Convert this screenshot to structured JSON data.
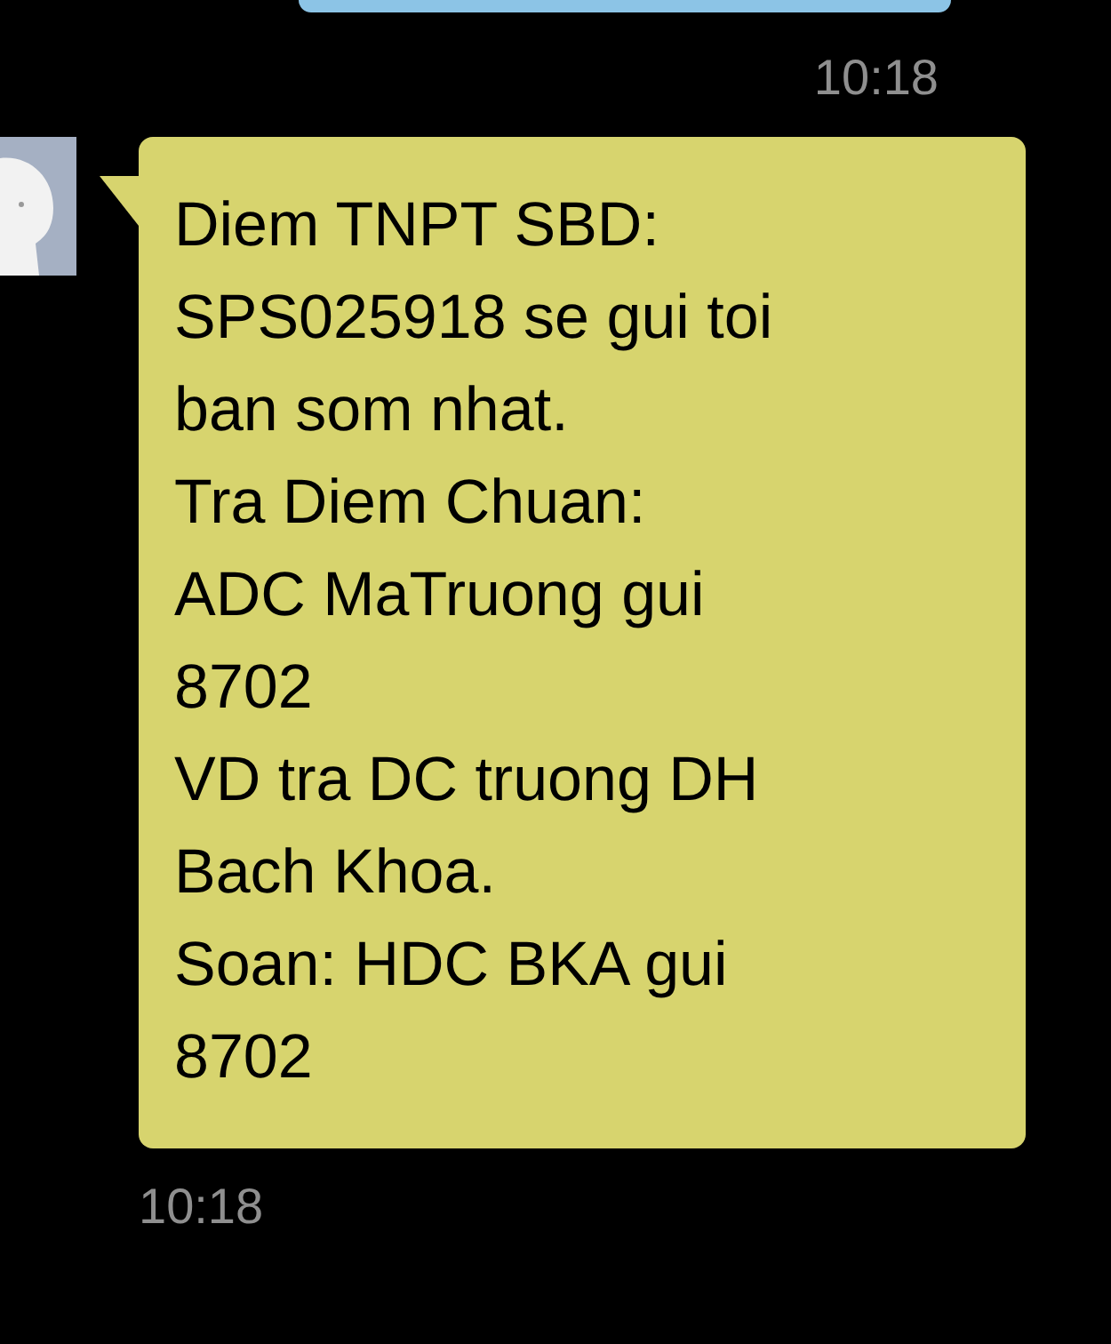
{
  "messages": [
    {
      "kind": "outgoing",
      "time": "10:18"
    },
    {
      "kind": "incoming",
      "text": "Diem TNPT SBD:\nSPS025918 se gui toi\nban som nhat.\nTra Diem Chuan:\nADC MaTruong gui\n8702\nVD tra DC truong DH\nBach Khoa.\nSoan: HDC BKA gui\n8702",
      "time": "10:18"
    }
  ]
}
